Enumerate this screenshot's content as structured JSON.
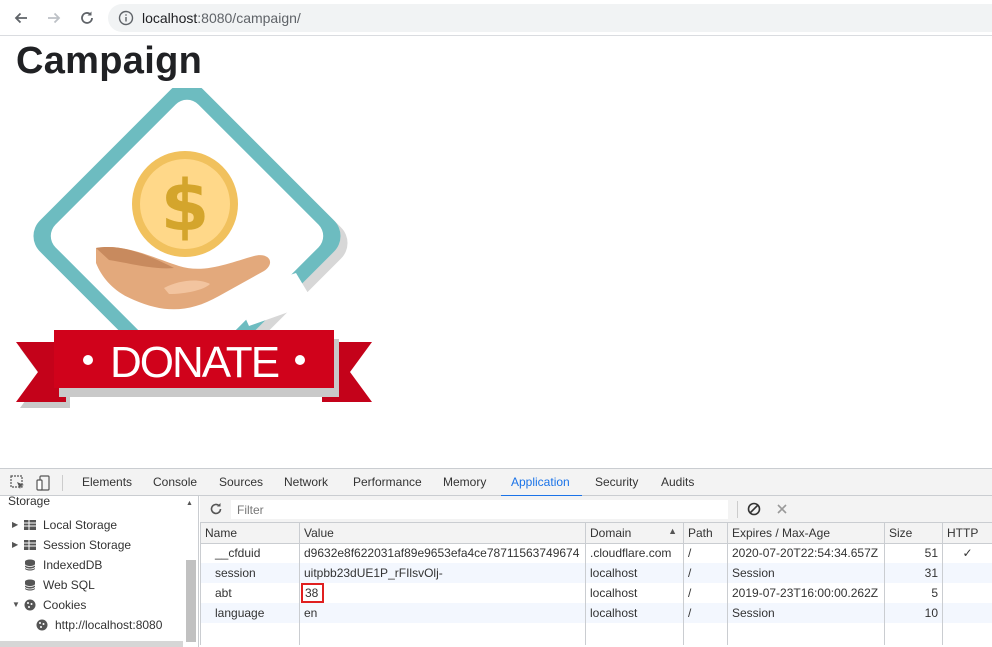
{
  "browser": {
    "url_host": "localhost",
    "url_rest": ":8080/campaign/"
  },
  "page": {
    "title": "Campaign",
    "banner_text": "DONATE"
  },
  "devtools": {
    "tabs": [
      "Elements",
      "Console",
      "Sources",
      "Network",
      "Performance",
      "Memory",
      "Application",
      "Security",
      "Audits"
    ],
    "active_tab": "Application",
    "sidebar": {
      "heading": "Storage",
      "items": [
        {
          "label": "Local Storage"
        },
        {
          "label": "Session Storage"
        },
        {
          "label": "IndexedDB"
        },
        {
          "label": "Web SQL"
        },
        {
          "label": "Cookies"
        },
        {
          "label": "http://localhost:8080"
        }
      ]
    },
    "filter_placeholder": "Filter",
    "columns": [
      "Name",
      "Value",
      "Domain",
      "Path",
      "Expires / Max-Age",
      "Size",
      "HTTP"
    ],
    "rows": [
      {
        "name": "__cfduid",
        "value": "d9632e8f622031af89e9653efa4ce78711563749674",
        "domain": ".cloudflare.com",
        "path": "/",
        "expires": "2020-07-20T22:54:34.657Z",
        "size": "51",
        "http": "✓"
      },
      {
        "name": "session",
        "value": "uitpbb23dUE1P_rFIlsvOlj-",
        "domain": "localhost",
        "path": "/",
        "expires": "Session",
        "size": "31",
        "http": ""
      },
      {
        "name": "abt",
        "value": "38",
        "domain": "localhost",
        "path": "/",
        "expires": "2019-07-23T16:00:00.262Z",
        "size": "5",
        "http": ""
      },
      {
        "name": "language",
        "value": "en",
        "domain": "localhost",
        "path": "/",
        "expires": "Session",
        "size": "10",
        "http": ""
      }
    ]
  },
  "colors": {
    "accent": "#1a73e8",
    "highlight": "#e02020",
    "banner_red": "#d0021b",
    "frame_teal": "#6dbcc0"
  }
}
